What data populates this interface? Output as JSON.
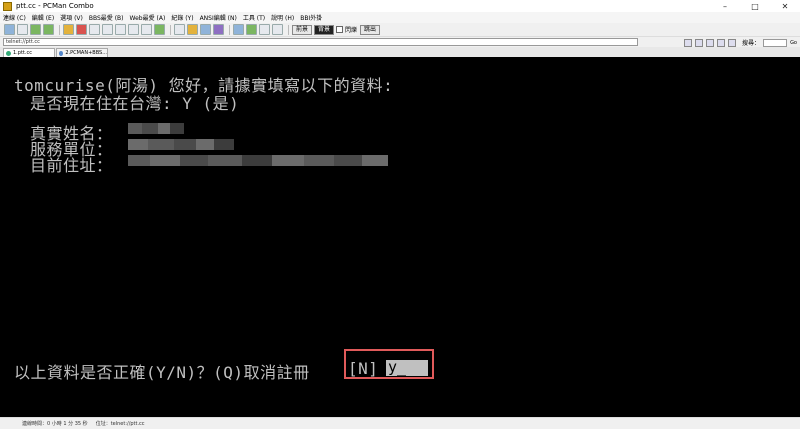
{
  "window": {
    "title": "ptt.cc - PCMan Combo",
    "min_glyph": "–",
    "max_glyph": "□",
    "close_glyph": "✕"
  },
  "menu": [
    "連線 (C)",
    "編輯 (E)",
    "選項 (V)",
    "BBS最愛 (B)",
    "Web最愛 (A)",
    "紀錄 (Y)",
    "ANSI編輯 (N)",
    "工具 (T)",
    "說明 (H)",
    "BBI外掛"
  ],
  "toolbar": {
    "fg_label": "前景",
    "bg_label": "背景",
    "blink_label": "閃爍",
    "exit_label": "跳出"
  },
  "address": {
    "value": "telnet://ptt.cc",
    "search_label": "搜尋：",
    "go_label": "Go"
  },
  "tabs": [
    {
      "label": "1.ptt.cc"
    },
    {
      "label": "2.PCMAN+BBS..."
    }
  ],
  "terminal": {
    "line1": "tomcurise(阿湯) 您好，請據實填寫以下的資料:",
    "line2": "是否現在住在台灣: Y (是)",
    "label_name": "真實姓名：",
    "label_work": "服務單位：",
    "label_address": "目前住址：",
    "confirm_prompt": "以上資料是否正確(Y/N)？(Q)取消註冊",
    "default_choice": "[N]",
    "input_value": "y_"
  },
  "status": {
    "time": "連線時間：0 小時 1 分 35 秒",
    "location": "位址：telnet://ptt.cc"
  }
}
